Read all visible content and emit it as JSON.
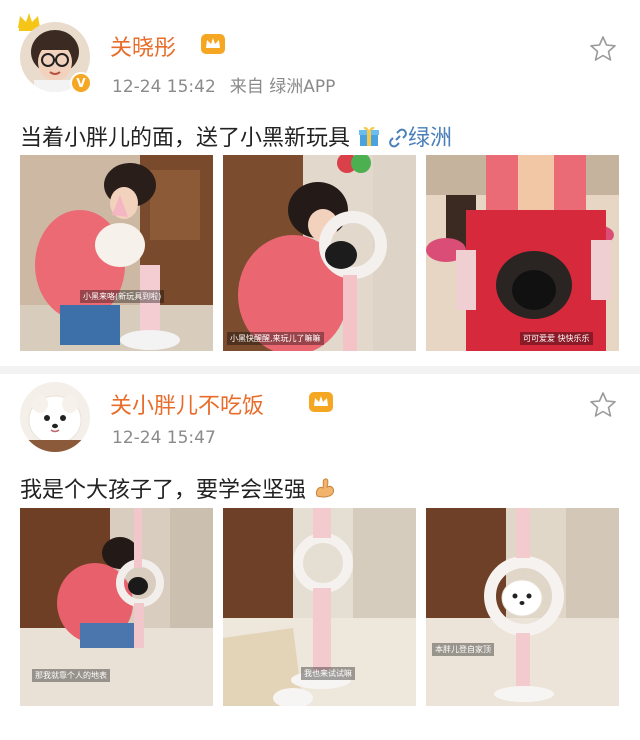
{
  "posts": [
    {
      "author": "关晓彤",
      "time": "12-24 15:42",
      "source": "来自 绿洲APP",
      "text": "当着小胖儿的面，送了小黑新玩具",
      "link_label": "绿洲",
      "verified_badge": "V",
      "images": [
        {
          "caption": "小黑来咯(新玩具到啦)"
        },
        {
          "caption": "小黑快醒醒,来玩儿了嘛嘛"
        },
        {
          "caption": "可可爱爱 快快乐乐"
        }
      ]
    },
    {
      "author": "关小胖儿不吃饭",
      "time": "12-24 15:47",
      "text": "我是个大孩子了，要学会坚强",
      "images": [
        {
          "caption": "那我就靠个人的地表"
        },
        {
          "caption": "我也来试试嘛"
        },
        {
          "caption": "本胖儿登自家顶"
        }
      ]
    }
  ],
  "colors": {
    "name": "#e86c2a",
    "meta": "#8a8a8a",
    "link": "#4a7fb8",
    "crown": "#f5a623"
  },
  "icons": [
    "crown-icon",
    "verified-badge-icon",
    "gift-icon",
    "link-icon",
    "flexed-biceps-icon",
    "star-outline-icon"
  ]
}
